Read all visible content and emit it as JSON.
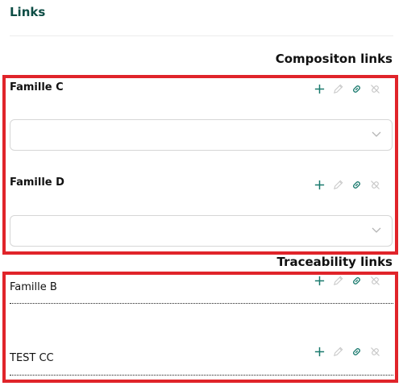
{
  "panel": {
    "title": "Links"
  },
  "composition": {
    "heading": "Compositon links",
    "groups": [
      {
        "label": "Famille C",
        "select_value": ""
      },
      {
        "label": "Famille D",
        "select_value": ""
      }
    ]
  },
  "traceability": {
    "heading": "Traceability links",
    "items": [
      {
        "label": "Famille B"
      },
      {
        "label": "TEST CC"
      }
    ]
  },
  "icons": {
    "add": "plus-icon",
    "edit": "pencil-icon",
    "link": "link-icon",
    "unlink": "unlink-icon",
    "dropdown": "chevron-down-icon"
  },
  "colors": {
    "title": "#0d4d45",
    "highlight_border": "#e0242a",
    "action_active": "#1a7a6e",
    "action_disabled": "#c8c8c8"
  }
}
